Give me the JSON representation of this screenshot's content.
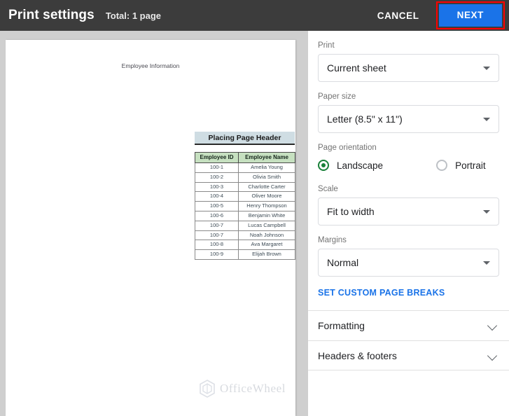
{
  "topbar": {
    "title": "Print settings",
    "total": "Total: 1 page",
    "cancel_label": "CANCEL",
    "next_label": "NEXT",
    "background": "#3c3c3c",
    "next_color": "#1a73e8",
    "highlight_color": "#ff0000"
  },
  "preview": {
    "doc_title": "Employee Information",
    "page_header": "Placing Page Header",
    "table": {
      "columns": [
        "Employee ID",
        "Employee Name"
      ],
      "rows": [
        [
          "100-1",
          "Amelia Young"
        ],
        [
          "100-2",
          "Olivia Smith"
        ],
        [
          "100-3",
          "Charlotte Carter"
        ],
        [
          "100-4",
          "Oliver Moore"
        ],
        [
          "100-5",
          "Henry Thompson"
        ],
        [
          "100-6",
          "Benjamin White"
        ],
        [
          "100-7",
          "Lucas Campbell"
        ],
        [
          "100-7",
          "Noah Johnson"
        ],
        [
          "100-8",
          "Ava Margaret"
        ],
        [
          "100-9",
          "Elijah Brown"
        ]
      ],
      "header_bg": "#c6e0c0",
      "page_header_bg": "#cfdde3"
    },
    "watermark": "OfficeWheel"
  },
  "settings": {
    "print": {
      "label": "Print",
      "value": "Current sheet"
    },
    "paper_size": {
      "label": "Paper size",
      "value": "Letter (8.5\" x 11\")"
    },
    "page_orientation": {
      "label": "Page orientation",
      "options": [
        {
          "label": "Landscape",
          "selected": true
        },
        {
          "label": "Portrait",
          "selected": false
        }
      ],
      "selected_color": "#188038"
    },
    "scale": {
      "label": "Scale",
      "value": "Fit to width"
    },
    "margins": {
      "label": "Margins",
      "value": "Normal"
    },
    "custom_page_breaks_label": "SET CUSTOM PAGE BREAKS",
    "sections": [
      {
        "label": "Formatting"
      },
      {
        "label": "Headers & footers"
      }
    ]
  }
}
